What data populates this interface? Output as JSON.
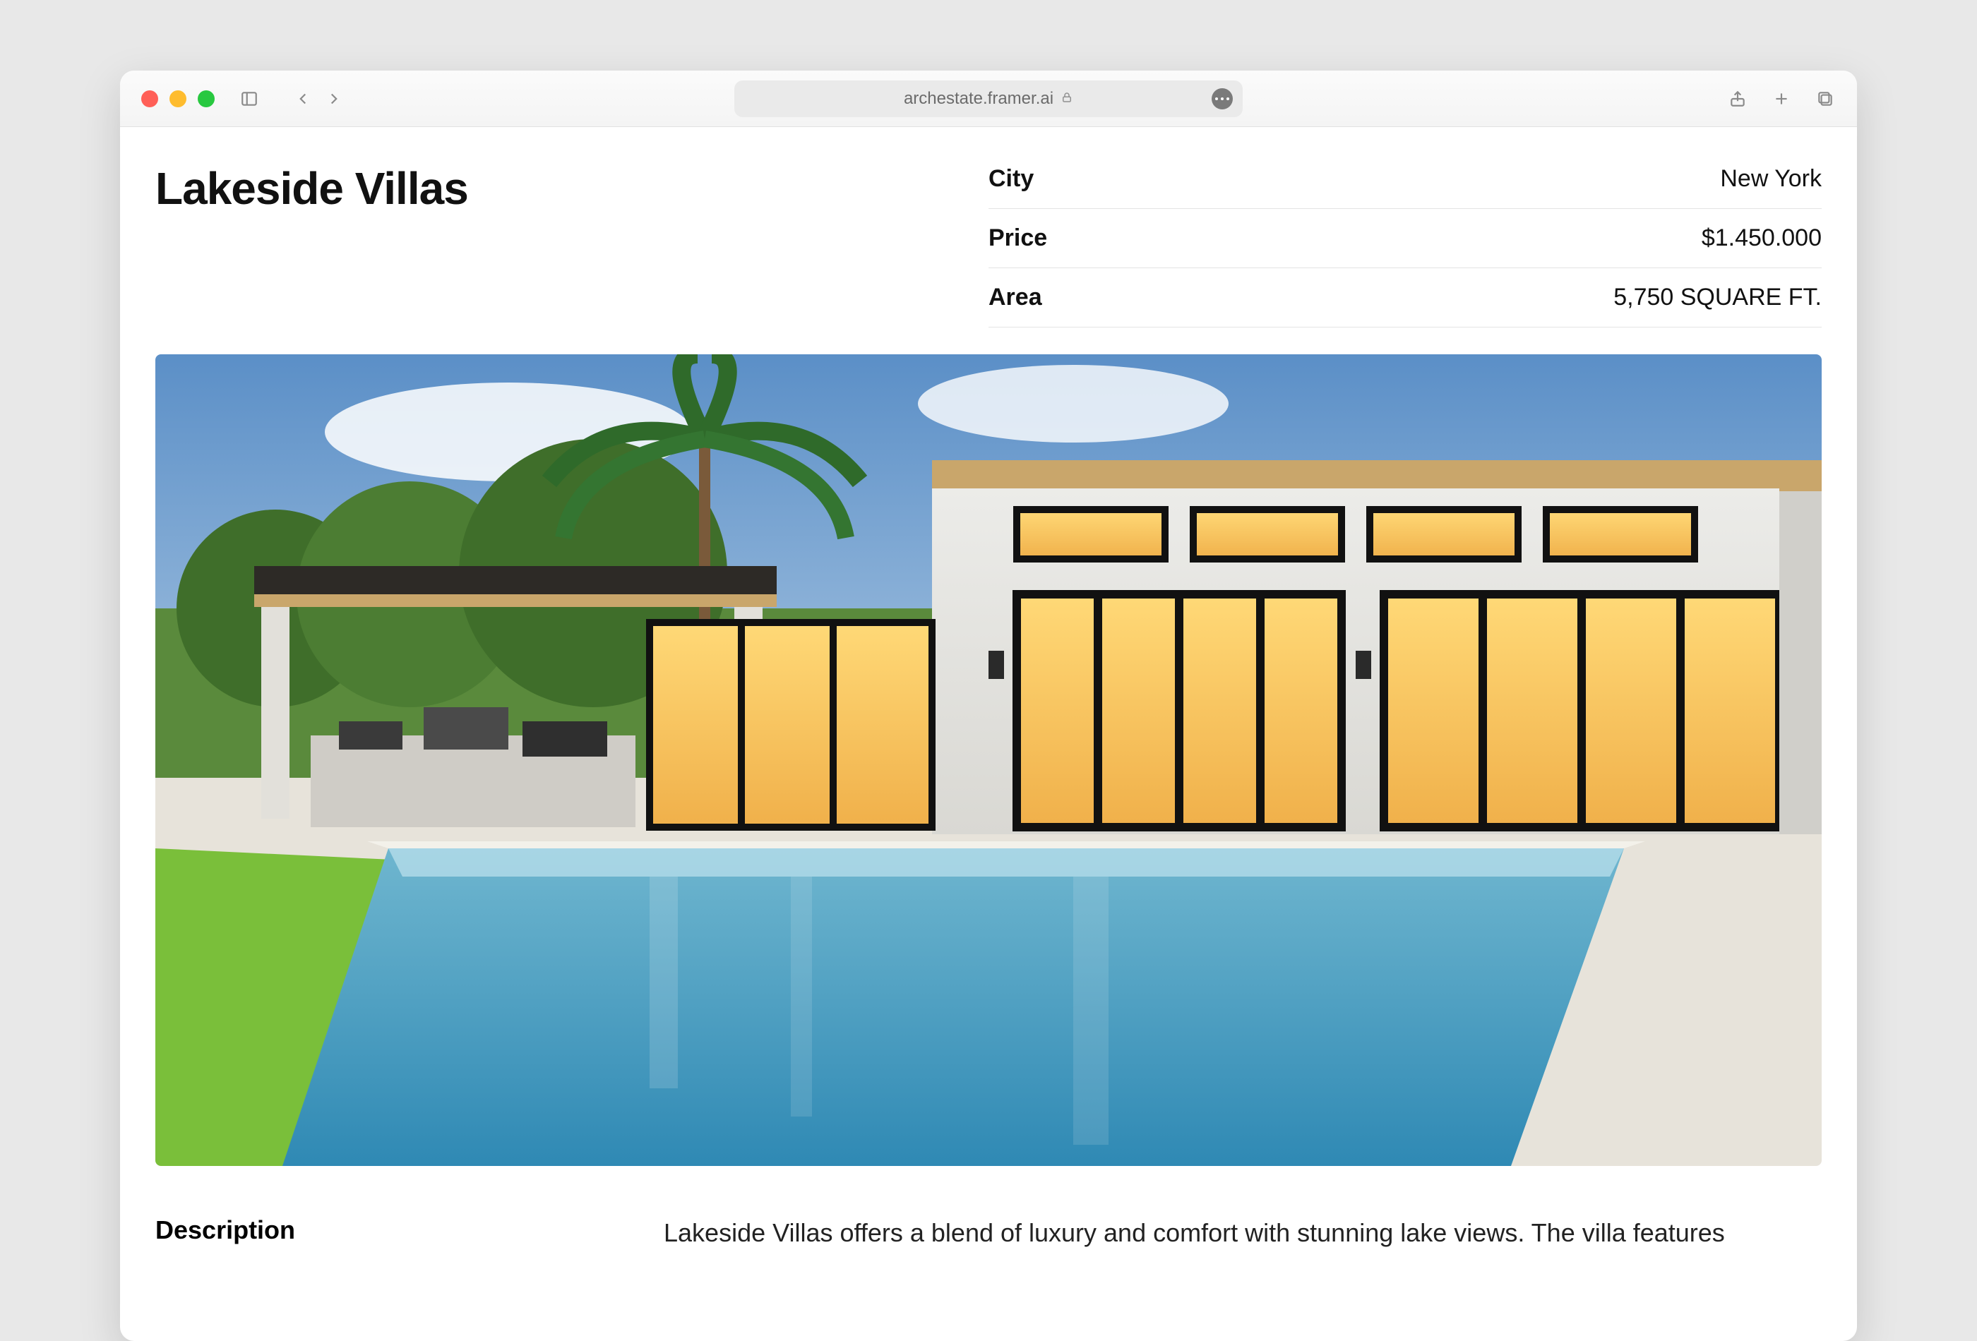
{
  "browser": {
    "url": "archestate.framer.ai"
  },
  "page": {
    "title": "Lakeside Villas",
    "specs": [
      {
        "label": "City",
        "value": "New York"
      },
      {
        "label": "Price",
        "value": "$1.450.000"
      },
      {
        "label": "Area",
        "value": "5,750 SQUARE FT."
      }
    ],
    "description_label": "Description",
    "description_text": "Lakeside Villas offers a blend of luxury and comfort with stunning lake views. The villa features"
  }
}
